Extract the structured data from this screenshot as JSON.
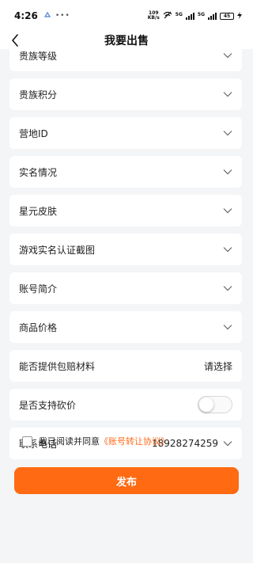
{
  "status": {
    "time": "4:26",
    "net_speed_value": "109",
    "net_speed_unit": "KB/s",
    "network_label": "5G",
    "network_label_2": "5G",
    "battery": "45"
  },
  "nav": {
    "title": "我要出售"
  },
  "form": {
    "fields": [
      {
        "label": "贵族等级"
      },
      {
        "label": "贵族积分"
      },
      {
        "label": "营地ID"
      },
      {
        "label": "实名情况"
      },
      {
        "label": "星元皮肤"
      },
      {
        "label": "游戏实名认证截图"
      },
      {
        "label": "账号简介"
      },
      {
        "label": "商品价格"
      }
    ],
    "compensation": {
      "label": "能否提供包赔材料",
      "value": "请选择"
    },
    "bargain": {
      "label": "是否支持砍价",
      "enabled": false
    },
    "phone": {
      "label": "联系电话",
      "value": "18928274259"
    }
  },
  "agreement": {
    "text": "我已阅读并同意",
    "link": "《账号转让协议》",
    "checked": false
  },
  "publish_button": "发布",
  "colors": {
    "accent": "#ff6a13",
    "link": "#ff6a1a",
    "background": "#f4f5f7"
  }
}
